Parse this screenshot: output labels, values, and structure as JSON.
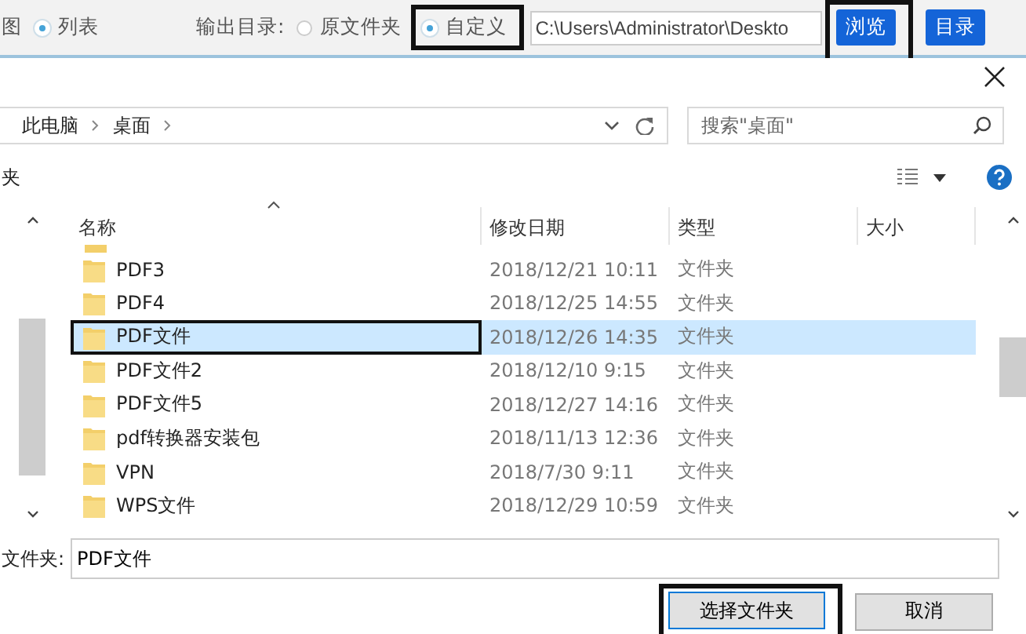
{
  "top_bar": {
    "view_label_cut": "图",
    "view_options": [
      {
        "label": "列表",
        "selected": true
      }
    ],
    "output_label": "输出目录:",
    "output_options": [
      {
        "label": "原文件夹",
        "selected": false,
        "highlighted": false
      },
      {
        "label": "自定义",
        "selected": true,
        "highlighted": true
      }
    ],
    "path": "C:\\Users\\Administrator\\Deskto",
    "buttons": [
      {
        "label": "浏览",
        "highlighted": true
      },
      {
        "label": "目录",
        "highlighted": false
      }
    ]
  },
  "dialog": {
    "breadcrumb": [
      "此电脑",
      "桌面"
    ],
    "search": {
      "placeholder": "搜索\"桌面\""
    },
    "toolbar_label_cut": "夹",
    "columns": [
      "名称",
      "修改日期",
      "类型",
      "大小"
    ],
    "rows": [
      {
        "name": "PDF3",
        "date": "2018/12/21 10:11",
        "type": "文件夹",
        "selected": false,
        "highlighted": false
      },
      {
        "name": "PDF4",
        "date": "2018/12/25 14:55",
        "type": "文件夹",
        "selected": false,
        "highlighted": false
      },
      {
        "name": "PDF文件",
        "date": "2018/12/26 14:35",
        "type": "文件夹",
        "selected": true,
        "highlighted": true
      },
      {
        "name": "PDF文件2",
        "date": "2018/12/10 9:15",
        "type": "文件夹",
        "selected": false,
        "highlighted": false
      },
      {
        "name": "PDF文件5",
        "date": "2018/12/27 14:16",
        "type": "文件夹",
        "selected": false,
        "highlighted": false
      },
      {
        "name": "pdf转换器安装包",
        "date": "2018/11/13 12:36",
        "type": "文件夹",
        "selected": false,
        "highlighted": false
      },
      {
        "name": "VPN",
        "date": "2018/7/30 9:11",
        "type": "文件夹",
        "selected": false,
        "highlighted": false
      },
      {
        "name": "WPS文件",
        "date": "2018/12/29 10:59",
        "type": "文件夹",
        "selected": false,
        "highlighted": false
      }
    ],
    "folder_label": "文件夹:",
    "folder_value": "PDF文件",
    "buttons": [
      {
        "label": "选择文件夹",
        "highlighted": true
      },
      {
        "label": "取消",
        "highlighted": false
      }
    ]
  }
}
